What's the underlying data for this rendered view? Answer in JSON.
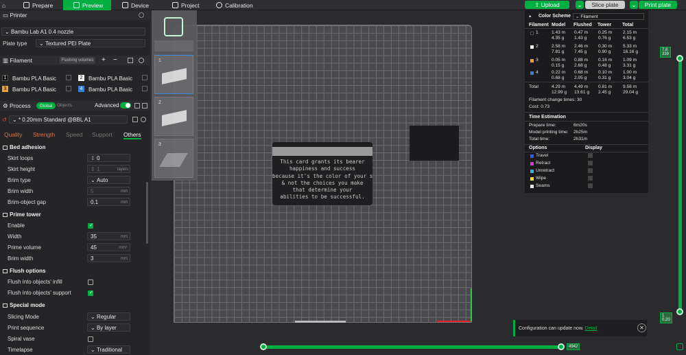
{
  "topbar": {
    "tabs": [
      {
        "label": "Prepare",
        "icon": "cube-icon"
      },
      {
        "label": "Preview",
        "icon": "layers-icon"
      },
      {
        "label": "Device",
        "icon": "device-icon"
      },
      {
        "label": "Project",
        "icon": "project-icon"
      },
      {
        "label": "Calibration",
        "icon": "calibration-icon"
      }
    ],
    "upload_label": "Upload",
    "slice_label": "Slice plate",
    "print_label": "Print plate"
  },
  "printer": {
    "header": "Printer",
    "model": "Bambu Lab A1 0.4 nozzle",
    "plate_type_label": "Plate type",
    "plate_type_value": "Textured PEI Plate"
  },
  "filament": {
    "header": "Filament",
    "flushing_label": "Flushing volumes",
    "slots": [
      {
        "num": "1",
        "name": "Bambu PLA Basic",
        "color": "#111111"
      },
      {
        "num": "2",
        "name": "Bambu PLA Basic",
        "color": "#f5f5f5"
      },
      {
        "num": "3",
        "name": "Bambu PLA Basic",
        "color": "#f0a030"
      },
      {
        "num": "4",
        "name": "Bambu PLA Basic",
        "color": "#3a7fd5"
      }
    ]
  },
  "process": {
    "header": "Process",
    "global_label": "Global",
    "objects_label": "Objects",
    "advanced_label": "Advanced",
    "preset": "* 0.20mm Standard @BBL A1",
    "tabs": [
      "Quality",
      "Strength",
      "Speed",
      "Support",
      "Others"
    ]
  },
  "settings": {
    "bed_adhesion": "Bed adhesion",
    "skirt_loops": {
      "label": "Skirt loops",
      "value": "0"
    },
    "skirt_height": {
      "label": "Skirt height",
      "value": "1",
      "unit": "layers"
    },
    "brim_type": {
      "label": "Brim type",
      "value": "Auto"
    },
    "brim_width": {
      "label": "Brim width",
      "value": "5",
      "unit": "mm"
    },
    "brim_gap": {
      "label": "Brim-object gap",
      "value": "0.1",
      "unit": "mm"
    },
    "prime_tower": "Prime tower",
    "pt_enable": {
      "label": "Enable"
    },
    "pt_width": {
      "label": "Width",
      "value": "35",
      "unit": "mm"
    },
    "pt_volume": {
      "label": "Prime volume",
      "value": "45",
      "unit": "mm³"
    },
    "pt_brim": {
      "label": "Brim width",
      "value": "3",
      "unit": "mm"
    },
    "flush_options": "Flush options",
    "flush_infill": {
      "label": "Flush into objects' infill"
    },
    "flush_support": {
      "label": "Flush into objects' support"
    },
    "special_mode": "Special mode",
    "slicing_mode": {
      "label": "Slicing Mode",
      "value": "Regular"
    },
    "print_sequence": {
      "label": "Print sequence",
      "value": "By layer"
    },
    "spiral_vase": {
      "label": "Spiral vase"
    },
    "timelapse": {
      "label": "Timelapse",
      "value": "Traditional"
    }
  },
  "plates": [
    "1",
    "2",
    "3"
  ],
  "card": {
    "lines": [
      "This card grants its bearer",
      "happiness and success",
      "because it's the color of your skin",
      "& not the choices you make",
      "that determine your",
      "abilities to be successful."
    ]
  },
  "stats": {
    "color_scheme_label": "Color Scheme",
    "color_scheme_value": "Filament",
    "headers": [
      "Filament",
      "Model",
      "Flushed",
      "Tower",
      "Total"
    ],
    "rows": [
      {
        "id": "1",
        "color": "#111111",
        "model": [
          "1.43 m",
          "4.35 g"
        ],
        "flushed": [
          "0.47 m",
          "1.43 g"
        ],
        "tower": [
          "0.25 m",
          "0.76 g"
        ],
        "total": [
          "2.15 m",
          "6.53 g"
        ]
      },
      {
        "id": "2",
        "color": "#f5f5f5",
        "model": [
          "2.58 m",
          "7.81 g"
        ],
        "flushed": [
          "2.46 m",
          "7.45 g"
        ],
        "tower": [
          "0.30 m",
          "0.90 g"
        ],
        "total": [
          "5.33 m",
          "16.16 g"
        ]
      },
      {
        "id": "3",
        "color": "#f0a030",
        "model": [
          "0.05 m",
          "0.15 g"
        ],
        "flushed": [
          "0.88 m",
          "2.68 g"
        ],
        "tower": [
          "0.16 m",
          "0.48 g"
        ],
        "total": [
          "1.09 m",
          "3.31 g"
        ]
      },
      {
        "id": "4",
        "color": "#3a7fd5",
        "model": [
          "0.22 m",
          "0.68 g"
        ],
        "flushed": [
          "0.68 m",
          "2.05 g"
        ],
        "tower": [
          "0.10 m",
          "0.31 g"
        ],
        "total": [
          "1.00 m",
          "3.04 g"
        ]
      }
    ],
    "total": {
      "label": "Total",
      "model": [
        "4.29 m",
        "12.99 g"
      ],
      "flushed": [
        "4.49 m",
        "13.61 g"
      ],
      "tower": [
        "0.81 m",
        "2.45 g"
      ],
      "total": [
        "9.58 m",
        "29.04 g"
      ]
    },
    "change_times": "Filament change times:   30",
    "cost": "Cost:   0.73",
    "time_header": "Time Estimation",
    "prepare_label": "Prepare time:",
    "prepare_value": "6m20s",
    "model_label": "Model printing time:",
    "model_value": "2h25m",
    "total_label": "Total time:",
    "total_value": "2h31m",
    "options_label": "Options",
    "display_label": "Display",
    "options": [
      {
        "name": "Travel",
        "color": "#2a5cff"
      },
      {
        "name": "Retract",
        "color": "#d43ad4"
      },
      {
        "name": "Unretract",
        "color": "#3ab0e0"
      },
      {
        "name": "Wipe",
        "color": "#f0e020"
      },
      {
        "name": "Seams",
        "color": "#e8e8e8"
      }
    ]
  },
  "sliders": {
    "top_tag": "7.8",
    "top_tag2": "339",
    "bottom_tag": "1",
    "bottom_tag2": "0.20",
    "h_tag": "4942"
  },
  "notification": {
    "text": "Configuration can update now.",
    "link": "Detail"
  }
}
